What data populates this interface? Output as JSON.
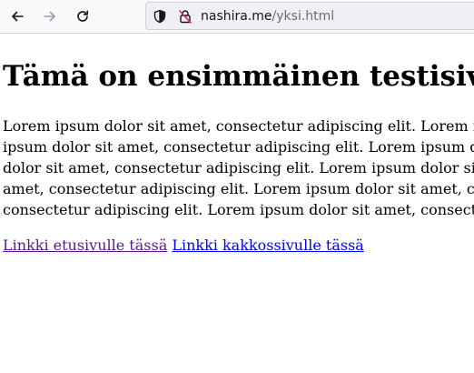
{
  "browser": {
    "url_host": "nashira.me",
    "url_path": "/yksi.html"
  },
  "page": {
    "heading": "Tämä on ensimmäinen testisivu",
    "paragraph_lines": [
      "Lorem ipsum dolor sit amet, consectetur adipiscing elit. Lorem ipsum dolor sit amet, consectetur adipiscing elit. Lorem",
      "ipsum dolor sit amet, consectetur adipiscing elit. Lorem ipsum dolor sit amet, consectetur adipiscing elit. Lorem ipsum",
      "dolor sit amet, consectetur adipiscing elit. Lorem ipsum dolor sit amet, consectetur adipiscing elit. Lorem ipsum dolor sit",
      "amet, consectetur adipiscing elit. Lorem ipsum dolor sit amet, consectetur adipiscing elit. Lorem ipsum dolor sit amet,",
      "consectetur adipiscing elit. Lorem ipsum dolor sit amet, consectetur adipiscing elit."
    ],
    "links": {
      "home": "Linkki etusivulle tässä",
      "second": "Linkki kakkossivulle tässä"
    }
  },
  "colors": {
    "visited_link": "#551a8b",
    "link": "#0000ee"
  }
}
